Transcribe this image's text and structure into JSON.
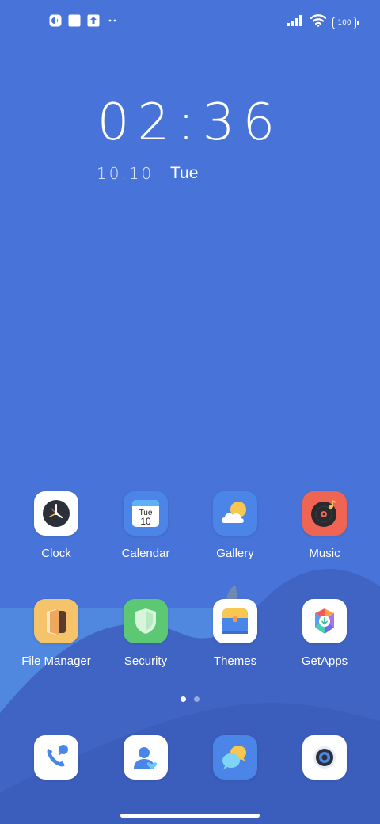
{
  "colors": {
    "wallpaper_top": "#4873d8",
    "wallpaper_wave": "#4f82e0",
    "wallpaper_hill": "#3e58b8",
    "accent_white": "#ffffff"
  },
  "status_bar": {
    "left_icons": [
      "notification-app-icon",
      "square-notification-icon",
      "upload-icon",
      "more-dots-icon"
    ],
    "signal_icon": "cellular-signal-icon",
    "wifi_icon": "wifi-icon",
    "battery_level": "100"
  },
  "lockclock": {
    "time": "02:36",
    "date": "10.10",
    "weekday": "Tue"
  },
  "apps": [
    {
      "label": "Clock",
      "icon": "clock-icon"
    },
    {
      "label": "Calendar",
      "icon": "calendar-icon",
      "day": "Tue",
      "date": "10"
    },
    {
      "label": "Gallery",
      "icon": "gallery-weather-icon"
    },
    {
      "label": "Music",
      "icon": "music-record-icon"
    },
    {
      "label": "File Manager",
      "icon": "folder-icon"
    },
    {
      "label": "Security",
      "icon": "shield-icon"
    },
    {
      "label": "Themes",
      "icon": "themes-box-icon"
    },
    {
      "label": "GetApps",
      "icon": "getapps-icon"
    }
  ],
  "page_indicator": {
    "pages": 2,
    "current": 1
  },
  "dock": [
    {
      "icon": "phone-icon"
    },
    {
      "icon": "contacts-icon"
    },
    {
      "icon": "messages-icon"
    },
    {
      "icon": "camera-icon"
    }
  ]
}
